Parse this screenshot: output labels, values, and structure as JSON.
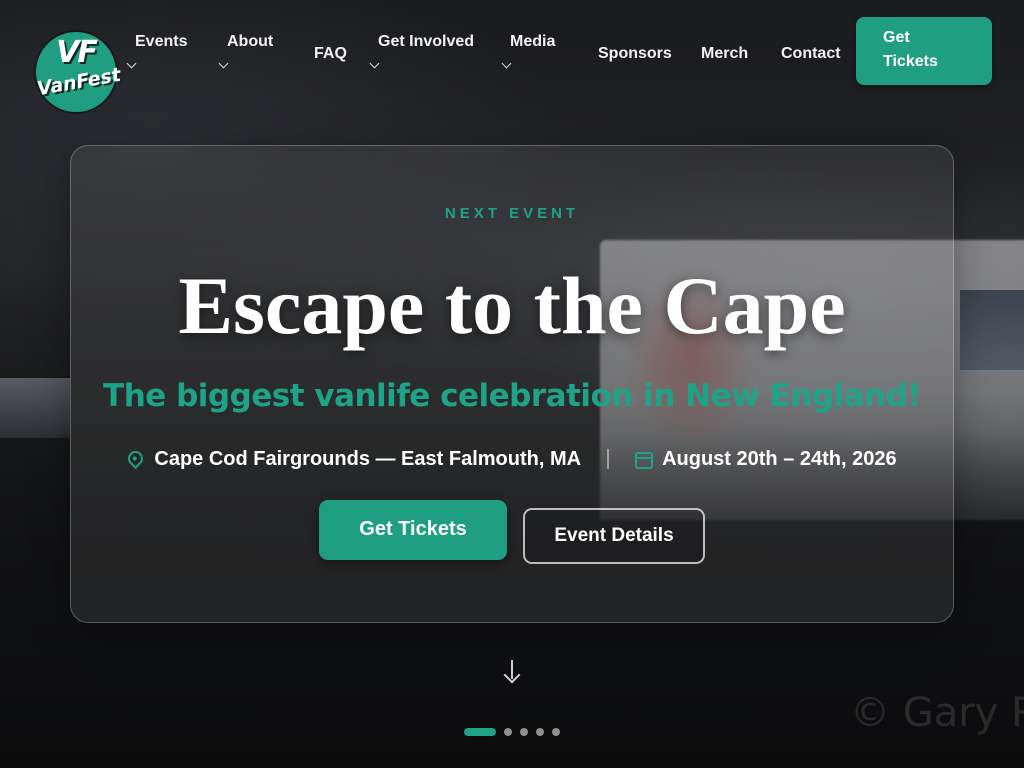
{
  "brand": {
    "logo_monogram": "VF",
    "logo_wordmark": "VanFest",
    "accent_color": "#1f9e82"
  },
  "nav": {
    "items": [
      {
        "label": "Events",
        "has_dropdown": true
      },
      {
        "label": "About",
        "has_dropdown": true
      },
      {
        "label": "FAQ",
        "has_dropdown": false
      },
      {
        "label": "Get Involved",
        "has_dropdown": true
      },
      {
        "label": "Media",
        "has_dropdown": true
      },
      {
        "label": "Sponsors",
        "has_dropdown": false
      },
      {
        "label": "Merch",
        "has_dropdown": false
      },
      {
        "label": "Contact",
        "has_dropdown": false
      }
    ],
    "cta_label": "Get Tickets"
  },
  "hero": {
    "eyebrow": "NEXT EVENT",
    "headline": "Escape to the Cape",
    "subhead": "The biggest vanlife celebration in New England!",
    "location_icon": "map-pin-icon",
    "location": "Cape Cod Fairgrounds — East Falmouth, MA",
    "date_icon": "calendar-icon",
    "dates": "August 20th – 24th, 2026",
    "primary_button": "Get Tickets",
    "secondary_button": "Event Details"
  },
  "scroll_icon": "arrow-down-icon",
  "carousel": {
    "slide_count": 5,
    "active_index": 0
  },
  "photo_credit": "© Gary Re"
}
